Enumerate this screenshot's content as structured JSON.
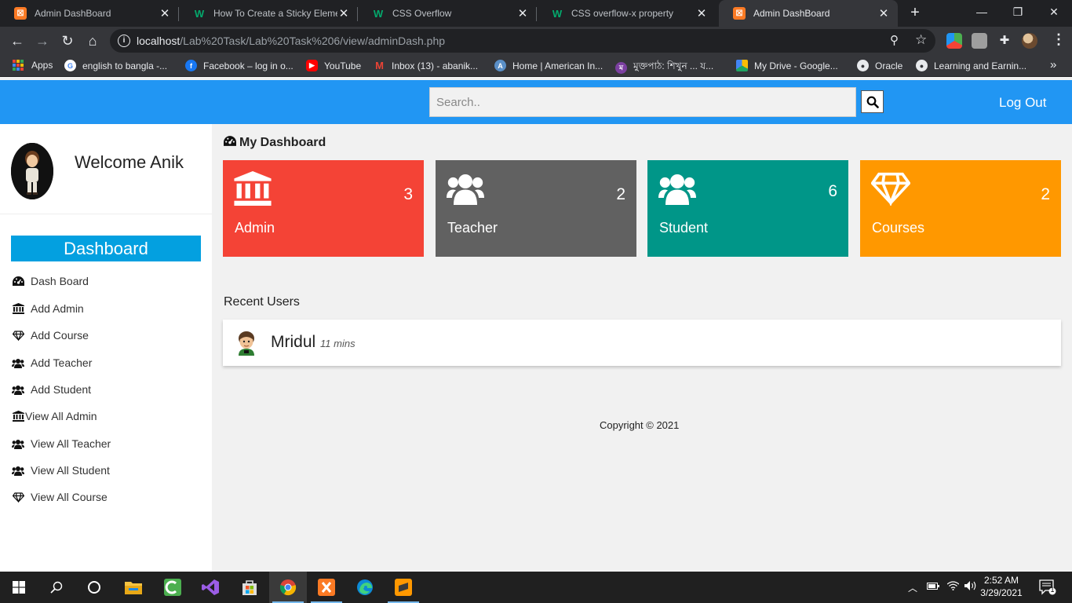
{
  "browser": {
    "tabs": [
      {
        "title": "Admin DashBoard",
        "favicon": "xampp-icon"
      },
      {
        "title": "How To Create a Sticky Elemen",
        "favicon": "w3schools-icon"
      },
      {
        "title": "CSS Overflow",
        "favicon": "w3schools-icon"
      },
      {
        "title": "CSS overflow-x property",
        "favicon": "w3schools-icon"
      },
      {
        "title": "Admin DashBoard",
        "favicon": "xampp-icon"
      }
    ],
    "active_tab": 4,
    "url_host": "localhost",
    "url_path": "/Lab%20Task/Lab%20Task%206/view/adminDash.php",
    "bookmarks": [
      {
        "label": "Apps",
        "icon": "apps-grid-icon"
      },
      {
        "label": "english to bangla -...",
        "icon": "google-icon",
        "color": "#4285f4"
      },
      {
        "label": "Facebook – log in o...",
        "icon": "facebook-icon",
        "color": "#1877f2"
      },
      {
        "label": "YouTube",
        "icon": "youtube-icon",
        "color": "#ff0000"
      },
      {
        "label": "Inbox (13) - abanik...",
        "icon": "gmail-icon",
        "color": "#ea4335"
      },
      {
        "label": "Home | American In...",
        "icon": "aiub-icon",
        "color": "#5a8fc7"
      },
      {
        "label": "মুক্তপাঠ: শিখুন ... য...",
        "icon": "muktopaath-icon",
        "color": "#7b3fa0"
      },
      {
        "label": "My Drive - Google...",
        "icon": "google-drive-icon",
        "color": "#1fa463"
      },
      {
        "label": "Oracle",
        "icon": "globe-icon",
        "color": "#e8eaed"
      },
      {
        "label": "Learning and Earnin...",
        "icon": "globe-icon",
        "color": "#e8eaed"
      }
    ]
  },
  "header": {
    "search_placeholder": "Search..",
    "logout_label": "Log Out",
    "bg_color": "#2196f3"
  },
  "sidebar": {
    "welcome": "Welcome Anik",
    "dashboard_label": "Dashboard",
    "items": [
      {
        "label": "Dash Board",
        "icon": "dashboard-icon"
      },
      {
        "label": "Add Admin",
        "icon": "institution-icon"
      },
      {
        "label": "Add Course",
        "icon": "diamond-icon"
      },
      {
        "label": "Add Teacher",
        "icon": "users-icon"
      },
      {
        "label": "Add Student",
        "icon": "users-icon"
      },
      {
        "label": "View All Admin",
        "icon": "institution-icon"
      },
      {
        "label": "View All Teacher",
        "icon": "users-icon"
      },
      {
        "label": "View All Student",
        "icon": "users-icon"
      },
      {
        "label": "View All Course",
        "icon": "diamond-icon"
      }
    ]
  },
  "main": {
    "title": "My Dashboard",
    "cards": [
      {
        "label": "Admin",
        "count": "3",
        "color": "#f44336",
        "icon": "institution-icon"
      },
      {
        "label": "Teacher",
        "count": "2",
        "color": "#616161",
        "icon": "users-icon"
      },
      {
        "label": "Student",
        "count": "6",
        "color": "#009688",
        "icon": "users-icon"
      },
      {
        "label": "Courses",
        "count": "2",
        "color": "#ff9800",
        "icon": "diamond-icon"
      }
    ],
    "recent_title": "Recent Users",
    "recent_users": [
      {
        "name": "Mridul",
        "time": "11 mins"
      }
    ],
    "copyright": "Copyright © 2021"
  },
  "taskbar": {
    "apps": [
      "windows-start-icon",
      "search-icon",
      "cortana-icon",
      "file-explorer-icon",
      "camtasia-icon",
      "visual-studio-icon",
      "store-icon",
      "chrome-icon",
      "xampp-icon",
      "edge-icon",
      "sublime-icon"
    ],
    "time": "2:52 AM",
    "date": "3/29/2021",
    "notification_count": "1"
  }
}
